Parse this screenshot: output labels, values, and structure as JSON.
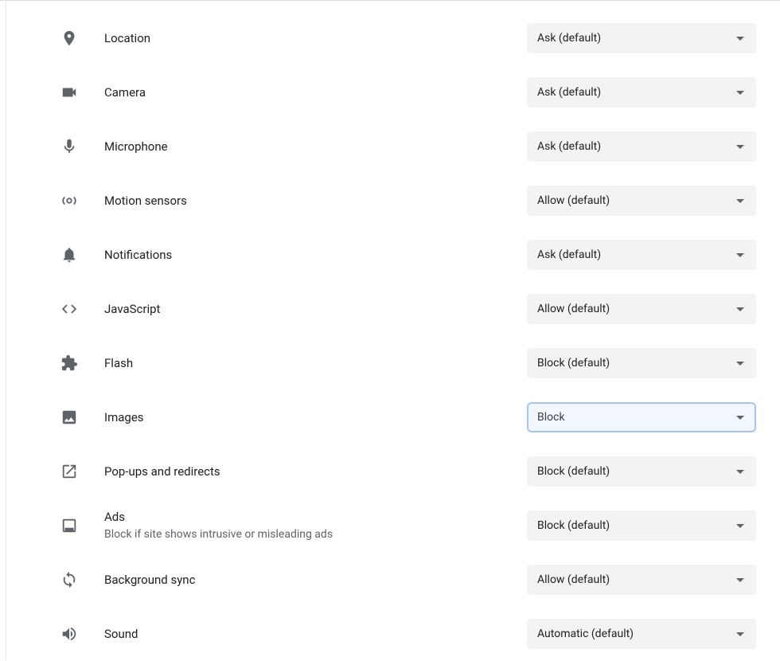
{
  "permissions": [
    {
      "id": "location",
      "icon": "location",
      "label": "Location",
      "sublabel": "",
      "value": "Ask (default)",
      "focused": false
    },
    {
      "id": "camera",
      "icon": "camera",
      "label": "Camera",
      "sublabel": "",
      "value": "Ask (default)",
      "focused": false
    },
    {
      "id": "microphone",
      "icon": "microphone",
      "label": "Microphone",
      "sublabel": "",
      "value": "Ask (default)",
      "focused": false
    },
    {
      "id": "motion-sensors",
      "icon": "motion-sensors",
      "label": "Motion sensors",
      "sublabel": "",
      "value": "Allow (default)",
      "focused": false
    },
    {
      "id": "notifications",
      "icon": "notifications",
      "label": "Notifications",
      "sublabel": "",
      "value": "Ask (default)",
      "focused": false
    },
    {
      "id": "javascript",
      "icon": "javascript",
      "label": "JavaScript",
      "sublabel": "",
      "value": "Allow (default)",
      "focused": false
    },
    {
      "id": "flash",
      "icon": "flash",
      "label": "Flash",
      "sublabel": "",
      "value": "Block (default)",
      "focused": false
    },
    {
      "id": "images",
      "icon": "images",
      "label": "Images",
      "sublabel": "",
      "value": "Block",
      "focused": true
    },
    {
      "id": "popups",
      "icon": "popups",
      "label": "Pop-ups and redirects",
      "sublabel": "",
      "value": "Block (default)",
      "focused": false
    },
    {
      "id": "ads",
      "icon": "ads",
      "label": "Ads",
      "sublabel": "Block if site shows intrusive or misleading ads",
      "value": "Block (default)",
      "focused": false
    },
    {
      "id": "background-sync",
      "icon": "background-sync",
      "label": "Background sync",
      "sublabel": "",
      "value": "Allow (default)",
      "focused": false
    },
    {
      "id": "sound",
      "icon": "sound",
      "label": "Sound",
      "sublabel": "",
      "value": "Automatic (default)",
      "focused": false
    }
  ]
}
